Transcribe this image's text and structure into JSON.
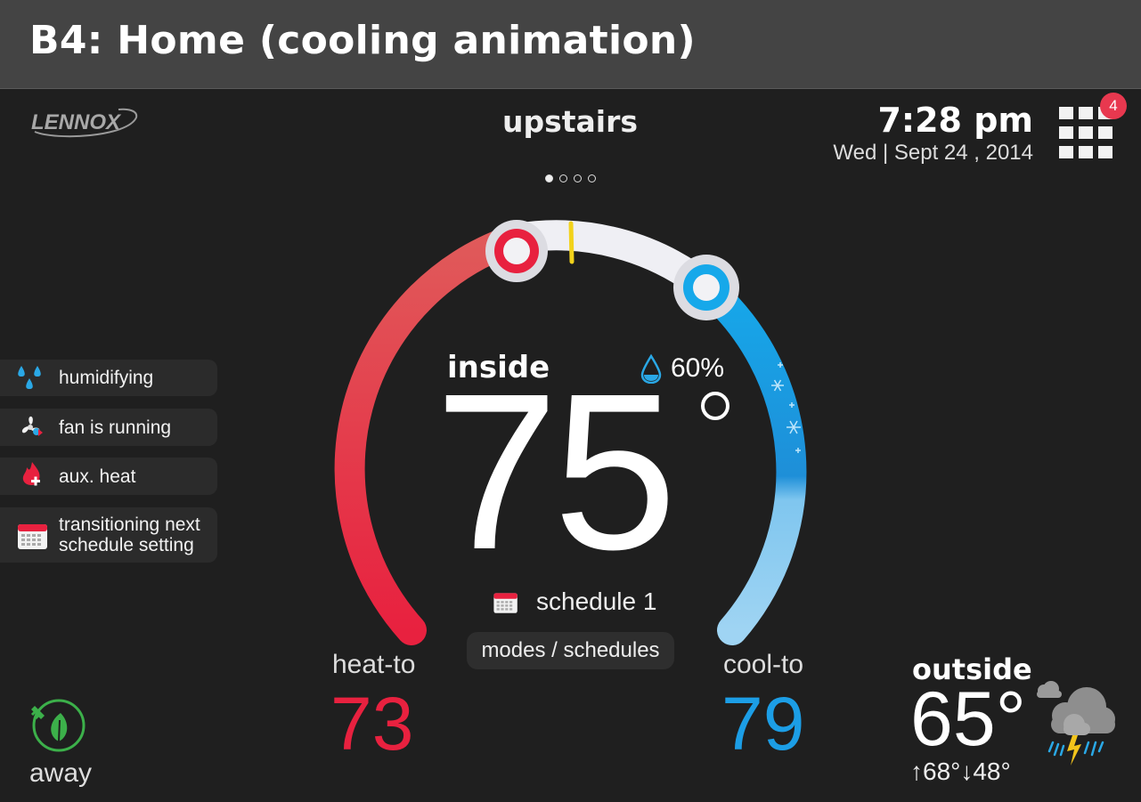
{
  "page_title": "B4: Home (cooling animation)",
  "brand": "LENNOX",
  "zone": {
    "name": "upstairs",
    "page_dots": 4,
    "active_dot": 0
  },
  "clock": {
    "time": "7:28 pm",
    "date": "Wed | Sept 24 , 2014"
  },
  "notifications": {
    "count": "4"
  },
  "status_items": [
    {
      "icon": "water-drops-icon",
      "label": "humidifying"
    },
    {
      "icon": "fan-icon",
      "label": "fan is running"
    },
    {
      "icon": "flame-plus-icon",
      "label": "aux. heat"
    },
    {
      "icon": "calendar-icon",
      "label": "transitioning next schedule setting"
    }
  ],
  "inside": {
    "label": "inside",
    "temperature": "75",
    "humidity": "60%"
  },
  "schedule": {
    "label": "schedule 1",
    "icon": "calendar-icon"
  },
  "modes_button": "modes / schedules",
  "heat": {
    "label": "heat-to",
    "value": "73"
  },
  "cool": {
    "label": "cool-to",
    "value": "79"
  },
  "away": {
    "label": "away",
    "icon": "leaf-plug-icon"
  },
  "outside": {
    "label": "outside",
    "temperature": "65°",
    "high_low": "↑68°↓48°",
    "icon": "storm-cloud-icon"
  },
  "colors": {
    "heat": "#e8213f",
    "cool": "#1c9ee6",
    "current_marker": "#f2d21b",
    "badge": "#e8384f"
  }
}
